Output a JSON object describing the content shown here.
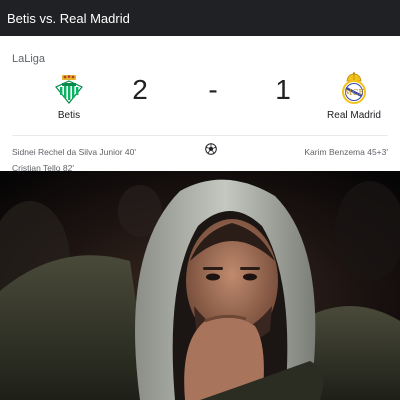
{
  "header": {
    "title": "Betis vs. Real Madrid"
  },
  "match": {
    "league": "LaLiga",
    "home": {
      "name": "Betis",
      "score": "2",
      "crest_icon": "betis-crest-icon",
      "color": "#0BB363"
    },
    "separator": "-",
    "away": {
      "name": "Real Madrid",
      "score": "1",
      "crest_icon": "real-madrid-crest-icon",
      "color": "#F3C21A"
    },
    "home_scorers": [
      "Sidnei Rechel da Silva Junior 40'",
      "Cristian Tello 82'"
    ],
    "away_scorers": [
      "Karim Benzema 45+3'"
    ],
    "goal_icon": "soccer-ball-icon"
  },
  "photo": {
    "subject": "hooded-man-reaction-photo"
  }
}
